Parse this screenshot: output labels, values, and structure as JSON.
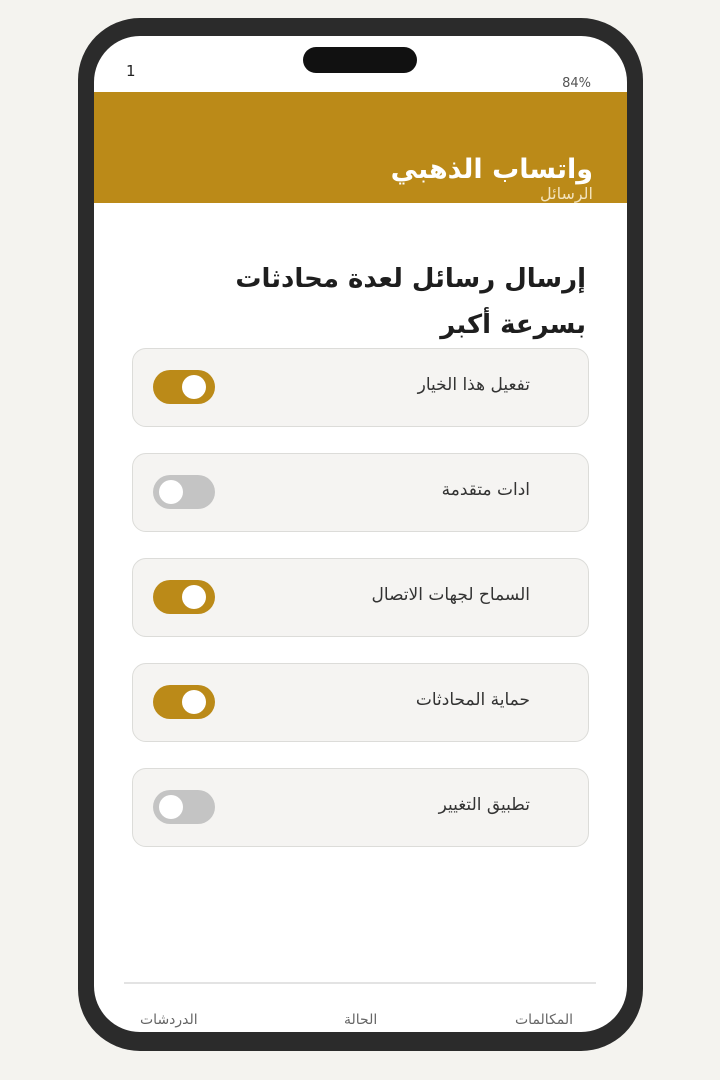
{
  "status_bar": {
    "time": "1",
    "battery": "84%"
  },
  "header": {
    "title": "واتساب الذهبي",
    "subtitle": "الرسائل"
  },
  "page": {
    "heading": "إرسال رسائل لعدة محادثات بسرعة أكبر"
  },
  "options": [
    {
      "label": "تفعيل هذا الخيار",
      "enabled": true
    },
    {
      "label": "ادات متقدمة",
      "enabled": false
    },
    {
      "label": "السماح لجهات الاتصال",
      "enabled": true
    },
    {
      "label": "حماية المحادثات",
      "enabled": true
    },
    {
      "label": "تطبيق التغيير",
      "enabled": false
    }
  ],
  "bottom_nav": {
    "chats": "الدردشات",
    "status": "الحالة",
    "calls": "المكالمات"
  },
  "colors": {
    "accent": "#bb8a18",
    "toggle_off": "#c4c4c4",
    "card_bg": "#f5f4f2"
  }
}
